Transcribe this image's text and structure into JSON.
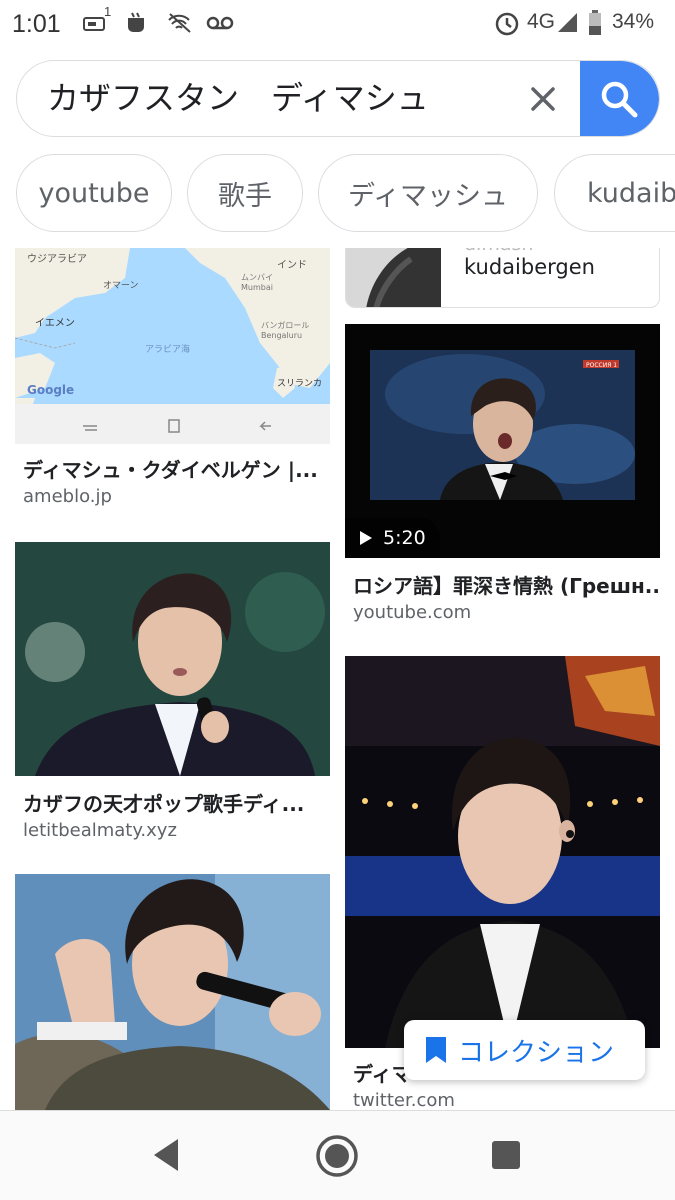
{
  "status_bar": {
    "time": "1:01",
    "notif_count": "1",
    "network": "4G",
    "battery": "34%"
  },
  "search": {
    "query": "カザフスタン　ディマシュ"
  },
  "chips": [
    "youtube",
    "歌手",
    "ディマッシュ",
    "kudaibe"
  ],
  "results": {
    "partial_top": {
      "faded": "dimash",
      "title": "kudaibergen"
    },
    "map_labels": [
      "ウジアラビア",
      "インド",
      "オマーン",
      "ムンバイ",
      "Mumbai",
      "イエメン",
      "バンガロール",
      "Bengaluru",
      "アラビア海",
      "スリランカ",
      "Google"
    ],
    "items": [
      {
        "title": "ディマシュ・クダイベルゲン |...",
        "source": "ameblo.jp"
      },
      {
        "title": "ロシア語】罪深き情熱 (Грешн...",
        "source": "youtube.com",
        "duration": "5:20",
        "channel": "РОССИЯ 1"
      },
      {
        "title": "カザフの天才ポップ歌手ディ...",
        "source": "letitbealmaty.xyz"
      },
      {
        "title": "ディマ",
        "source": "twitter.com"
      }
    ]
  },
  "collection": {
    "label": "コレクション"
  },
  "colors": {
    "accent": "#4285f4",
    "link_blue": "#1a73e8",
    "chip_border": "#dadce0"
  }
}
